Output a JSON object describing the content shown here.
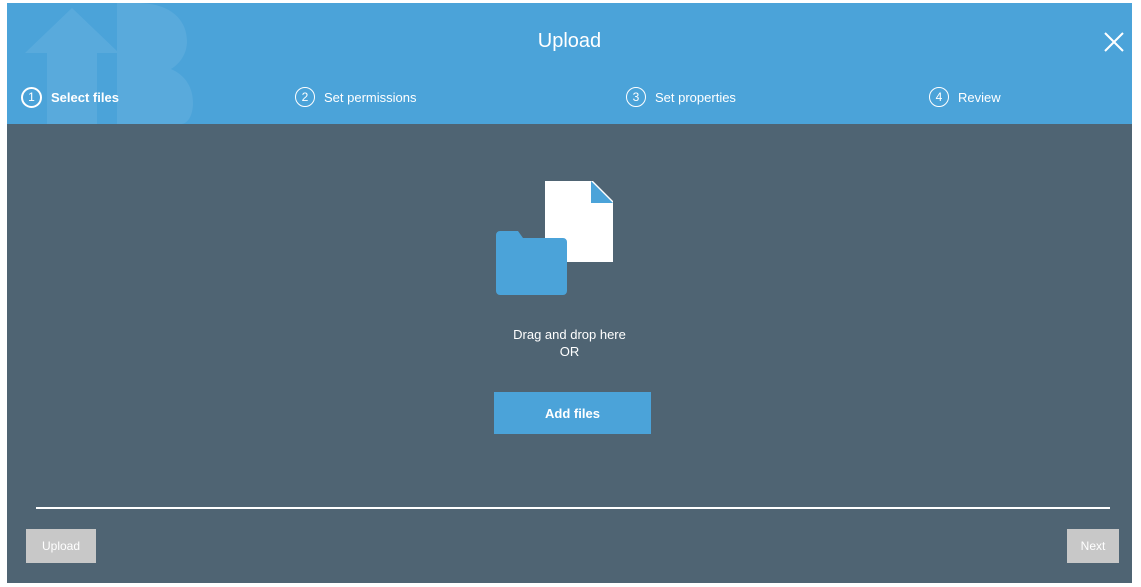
{
  "dialog": {
    "title": "Upload",
    "close_icon": "close-icon"
  },
  "steps": [
    {
      "number": "1",
      "label": "Select files",
      "active": true
    },
    {
      "number": "2",
      "label": "Set permissions",
      "active": false
    },
    {
      "number": "3",
      "label": "Set properties",
      "active": false
    },
    {
      "number": "4",
      "label": "Review",
      "active": false
    }
  ],
  "dropzone": {
    "illustration_icon": "folder-and-file-icon",
    "line1": "Drag and drop here",
    "line2": "OR",
    "add_files_label": "Add files"
  },
  "footer": {
    "upload_label": "Upload",
    "next_label": "Next"
  },
  "colors": {
    "header": "#4ba3d9",
    "body": "#4f6473",
    "accent": "#4ba3d9",
    "disabled_button": "#c8c8c8"
  }
}
